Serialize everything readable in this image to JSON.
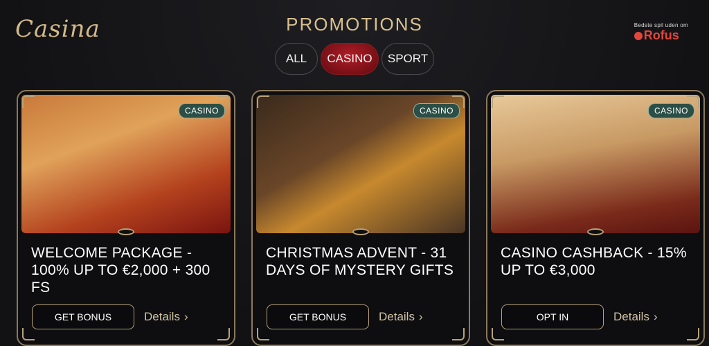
{
  "header": {
    "logo": "Casina",
    "title": "PROMOTIONS",
    "rofus_small": "Bedste spil uden om",
    "rofus_brand": "Rofus"
  },
  "tabs": [
    {
      "label": "ALL"
    },
    {
      "label": "CASINO",
      "active": true
    },
    {
      "label": "SPORT"
    }
  ],
  "cards": [
    {
      "badge": "CASINO",
      "title": "WELCOME PACKAGE - 100% UP TO €2,000 + 300 FS",
      "button": "GET BONUS",
      "details": "Details"
    },
    {
      "badge": "CASINO",
      "title": "CHRISTMAS ADVENT - 31 DAYS OF MYSTERY GIFTS",
      "button": "GET BONUS",
      "details": "Details"
    },
    {
      "badge": "CASINO",
      "title": "CASINO CASHBACK - 15% UP TO €3,000",
      "button": "OPT IN",
      "details": "Details"
    }
  ],
  "colors": {
    "accent_gold": "#d9c08f",
    "active_tab": "#b01d26",
    "badge_bg": "#2b4f46",
    "rofus_red": "#e2453c"
  }
}
